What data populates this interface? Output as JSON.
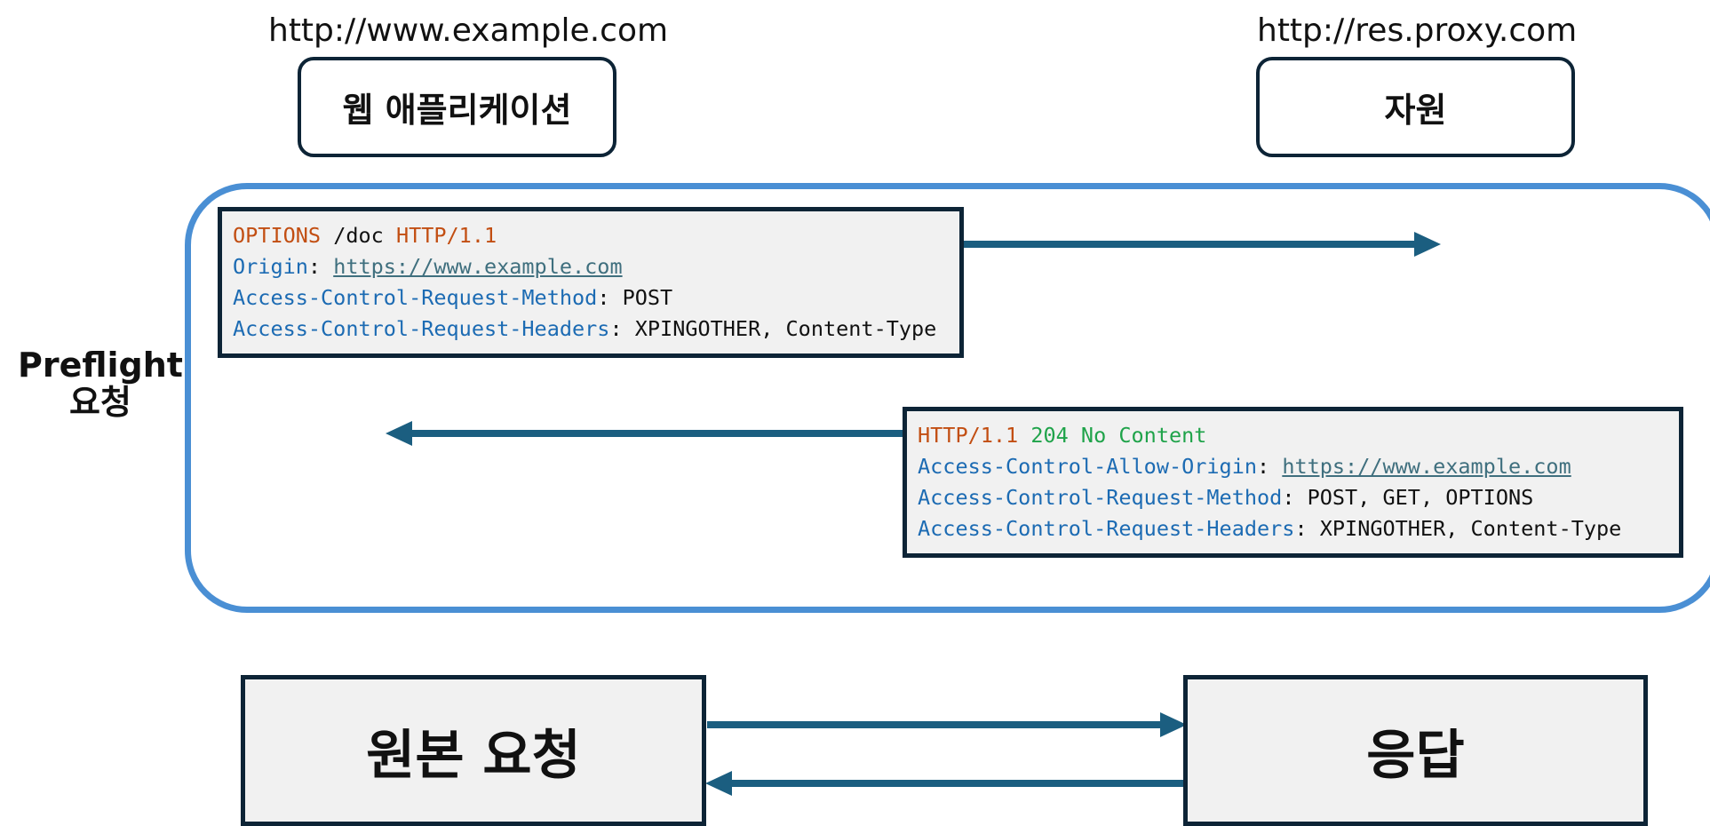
{
  "client": {
    "url": "http://www.example.com",
    "label": "웹 애플리케이션"
  },
  "server": {
    "url": "http://res.proxy.com",
    "label": "자원"
  },
  "preflight": {
    "label_line1": "Preflight",
    "label_line2": "요청"
  },
  "preflight_request": {
    "method": "OPTIONS",
    "path": " /doc ",
    "version": "HTTP/1.1",
    "origin_key": "Origin",
    "origin_sep": ": ",
    "origin_value": "https://www.example.com",
    "method_key": "Access-Control-Request-Method",
    "method_sep": ": ",
    "method_value": "POST",
    "headers_key": "Access-Control-Request-Headers",
    "headers_sep": ": ",
    "headers_value": "XPINGOTHER, Content-Type"
  },
  "preflight_response": {
    "version": "HTTP/1.1",
    "status": " 204 No Content",
    "allow_origin_key": "Access-Control-Allow-Origin",
    "allow_origin_sep": ": ",
    "allow_origin_value": "https://www.example.com",
    "method_key": "Access-Control-Request-Method",
    "method_sep": ": ",
    "method_value": "POST, GET, OPTIONS",
    "headers_key": "Access-Control-Request-Headers",
    "headers_sep": ": ",
    "headers_value": "XPINGOTHER, Content-Type"
  },
  "main_exchange": {
    "request_label": "원본 요청",
    "response_label": "응답"
  },
  "colors": {
    "arrow": "#1b5e80",
    "frame": "#4a8fd4",
    "box_border": "#0d2436",
    "box_fill": "#f1f1f1"
  }
}
